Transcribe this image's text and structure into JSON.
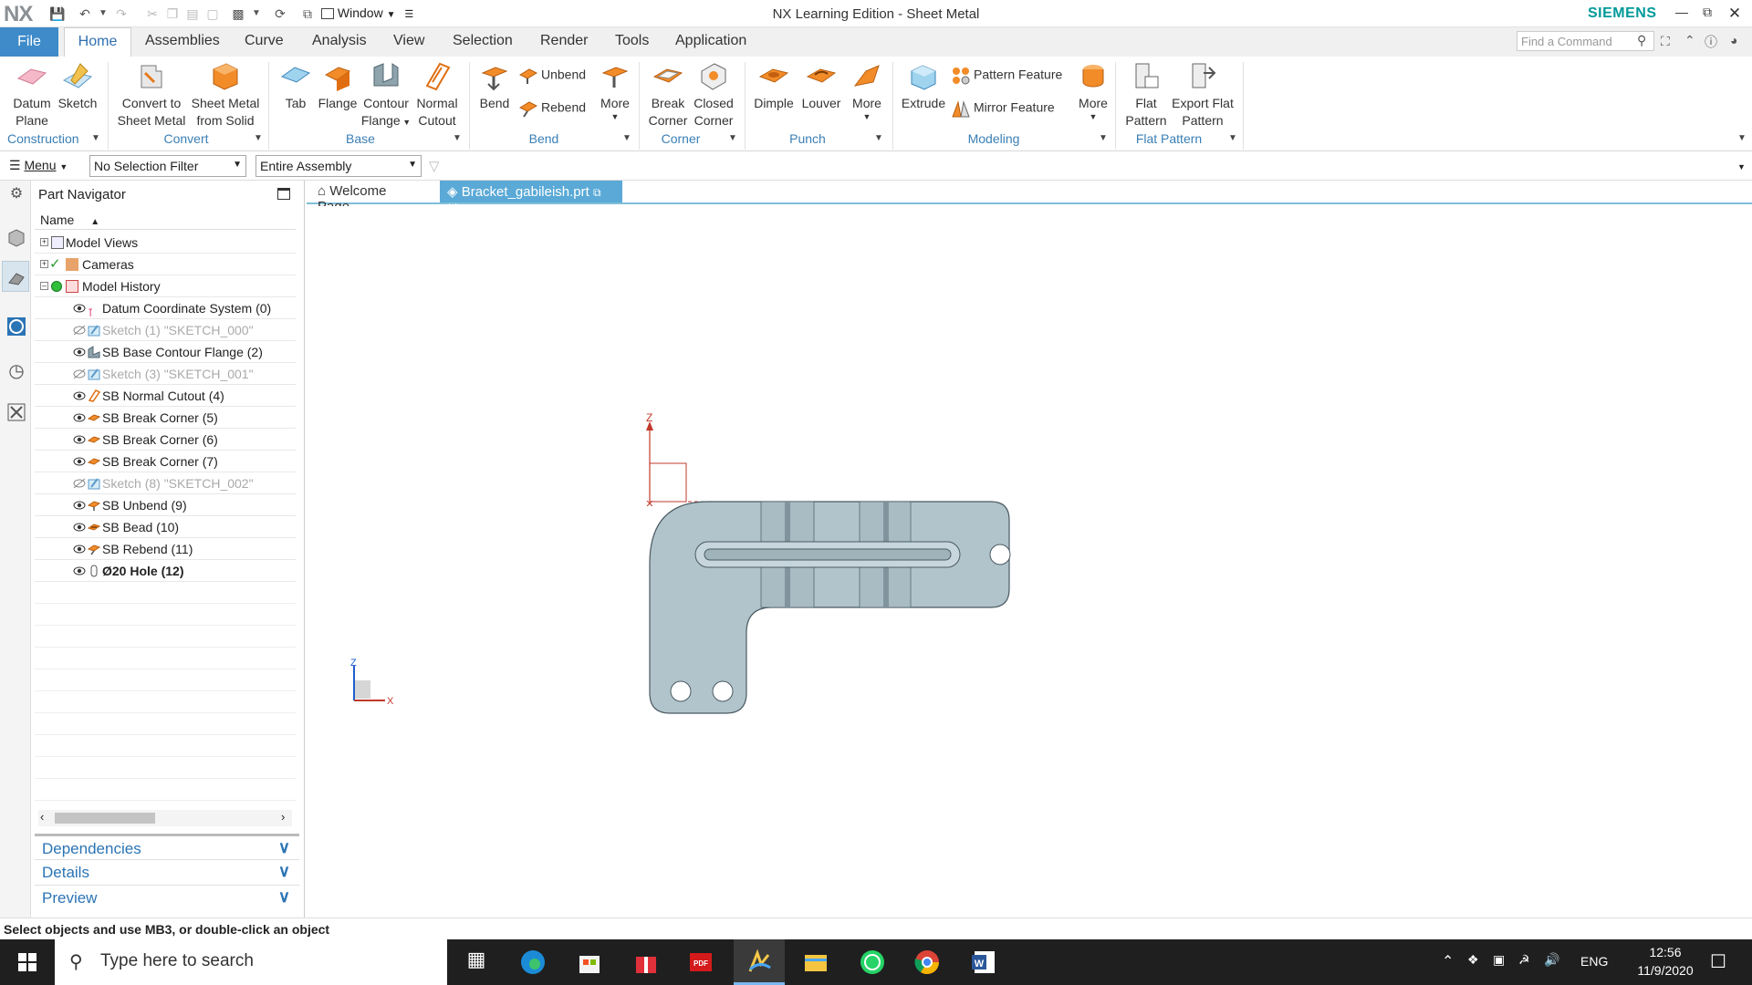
{
  "app": {
    "logo": "NX",
    "window_menu": "Window",
    "title": "NX Learning Edition - Sheet Metal",
    "brand": "SIEMENS"
  },
  "ribbon_tabs": [
    "File",
    "Home",
    "Assemblies",
    "Curve",
    "Analysis",
    "View",
    "Selection",
    "Render",
    "Tools",
    "Application"
  ],
  "find_command": {
    "placeholder": "Find a Command"
  },
  "ribbon": {
    "datum_plane": "Datum Plane",
    "sketch": "Sketch",
    "convert_to_sheet_metal": "Convert to Sheet Metal",
    "sheet_metal_from_solid": "Sheet Metal from Solid",
    "tab": "Tab",
    "flange": "Flange",
    "contour_flange": "Contour Flange",
    "normal_cutout": "Normal Cutout",
    "bend": "Bend",
    "unbend": "Unbend",
    "rebend": "Rebend",
    "more_bend": "More",
    "break_corner": "Break Corner",
    "closed_corner": "Closed Corner",
    "dimple": "Dimple",
    "louver": "Louver",
    "more_punch": "More",
    "extrude": "Extrude",
    "pattern_feature": "Pattern Feature",
    "mirror_feature": "Mirror Feature",
    "more_modeling": "More",
    "flat_pattern": "Flat Pattern",
    "export_flat_pattern": "Export Flat Pattern",
    "groups": {
      "construction": "Construction",
      "convert": "Convert",
      "base": "Base",
      "bend": "Bend",
      "corner": "Corner",
      "punch": "Punch",
      "modeling": "Modeling",
      "flat_pattern": "Flat Pattern"
    }
  },
  "filterbar": {
    "menu": "Menu",
    "selection_filter": "No Selection Filter",
    "scope": "Entire Assembly"
  },
  "navigator": {
    "title": "Part Navigator",
    "column": "Name",
    "top_nodes": [
      "Model Views",
      "Cameras",
      "Model History"
    ],
    "history": [
      {
        "label": "Datum Coordinate System (0)",
        "state": "normal"
      },
      {
        "label": "Sketch (1) \"SKETCH_000\"",
        "state": "dim"
      },
      {
        "label": "SB Base Contour Flange (2)",
        "state": "normal"
      },
      {
        "label": "Sketch (3) \"SKETCH_001\"",
        "state": "dim"
      },
      {
        "label": "SB Normal Cutout (4)",
        "state": "normal"
      },
      {
        "label": "SB Break Corner (5)",
        "state": "normal"
      },
      {
        "label": "SB Break Corner (6)",
        "state": "normal"
      },
      {
        "label": "SB Break Corner (7)",
        "state": "normal"
      },
      {
        "label": "Sketch (8) \"SKETCH_002\"",
        "state": "dim"
      },
      {
        "label": "SB Unbend (9)",
        "state": "normal"
      },
      {
        "label": "SB Bead (10)",
        "state": "normal"
      },
      {
        "label": "SB Rebend (11)",
        "state": "normal"
      },
      {
        "label": "Ø20 Hole (12)",
        "state": "bold"
      }
    ],
    "sections": [
      "Dependencies",
      "Details",
      "Preview"
    ]
  },
  "doc_tabs": {
    "welcome": "Welcome Page",
    "active": "Bracket_gabileish.prt"
  },
  "viewport": {
    "axis_z": "Z",
    "axis_x": "X",
    "part_color": "#b2c4cb"
  },
  "status": "Select objects and use MB3, or double-click an object",
  "taskbar": {
    "search_placeholder": "Type here to search",
    "lang": "ENG",
    "time": "12:56",
    "date": "11/9/2020"
  }
}
